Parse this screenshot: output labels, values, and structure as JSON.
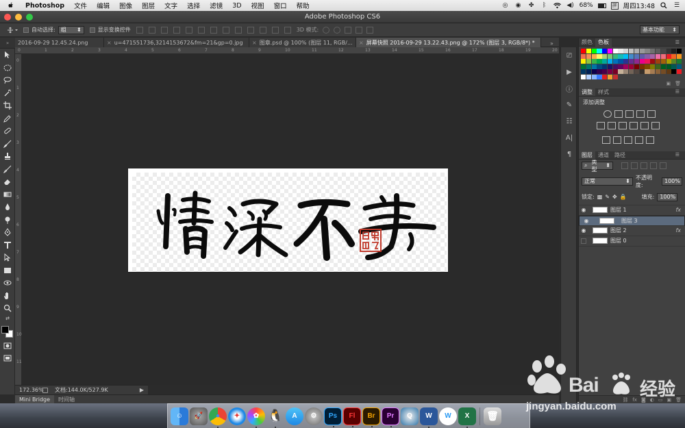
{
  "menubar": {
    "app": "Photoshop",
    "items": [
      "文件",
      "编辑",
      "图像",
      "图层",
      "文字",
      "选择",
      "滤镜",
      "3D",
      "视图",
      "窗口",
      "帮助"
    ],
    "battery": "68%",
    "clock": "周四13:48"
  },
  "window": {
    "title": "Adobe Photoshop CS6"
  },
  "options": {
    "auto_select_label": "自动选择:",
    "auto_select_value": "组",
    "show_transform_label": "显示变换控件",
    "mode_3d_label": "3D 模式:",
    "workspace": "基本功能"
  },
  "tabs": [
    {
      "label": "2016-09-29 12.45.24.png"
    },
    {
      "label": "u=471551736,3214153672&fm=21&gp=0.jpg"
    },
    {
      "label": "图章.psd @ 100% (图层 11, RGB/..."
    },
    {
      "label": "屏幕快照 2016-09-29 13.22.43.png @ 172% (图层 3, RGB/8*) *"
    }
  ],
  "status": {
    "zoom": "172.36%",
    "doc": "文档:144.0K/527.9K"
  },
  "bottom_tabs": [
    "Mini Bridge",
    "时间轴"
  ],
  "panels": {
    "color_tabs": [
      "颜色",
      "色板"
    ],
    "adjust_tabs": [
      "调整",
      "样式"
    ],
    "adjust_title": "添加调整",
    "layer_tabs": [
      "图层",
      "通道",
      "路径"
    ],
    "kind_label": "类型",
    "blend_mode": "正常",
    "opacity_label": "不透明度:",
    "opacity_value": "100%",
    "lock_label": "锁定:",
    "fill_label": "填充:",
    "fill_value": "100%",
    "layers": [
      {
        "name": "图层 1",
        "fx": true,
        "selected": false
      },
      {
        "name": "图层 3",
        "fx": false,
        "selected": true
      },
      {
        "name": "图层 2",
        "fx": true,
        "selected": false
      },
      {
        "name": "图层 0",
        "fx": false,
        "selected": false
      }
    ]
  },
  "canvas": {
    "calligraphy_text": "情深不寿",
    "seal_text": "印章"
  },
  "watermark": {
    "brand": "Bai",
    "brand2": "经验",
    "url": "jingyan.baidu.com"
  },
  "dock_apps": [
    "Finder",
    "Launchpad",
    "Chrome",
    "Safari",
    "Photos",
    "QQ",
    "App Store",
    "System Preferences",
    "Ps",
    "Fl",
    "Br",
    "Pr",
    "QuickTime",
    "Word",
    "Wunderlist",
    "Excel",
    "Trash"
  ]
}
